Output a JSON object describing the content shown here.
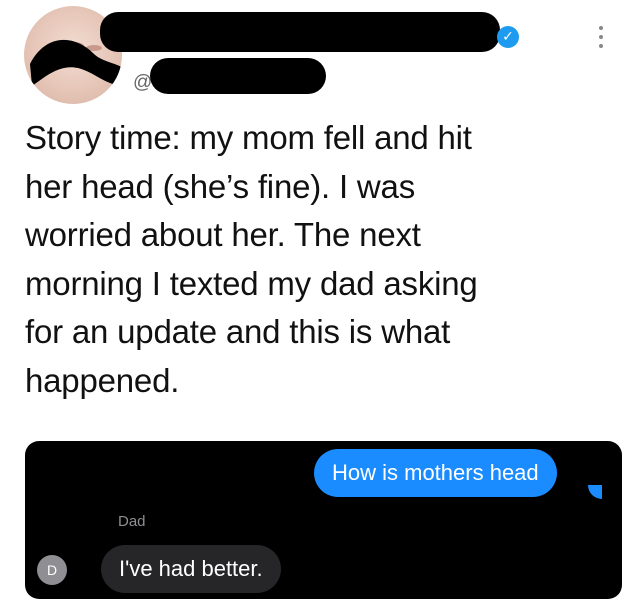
{
  "tweet": {
    "handle_visible": "@",
    "lines": [
      "Story time: my mom fell and hit",
      "her head (she’s fine). I was",
      "worried about her. The next",
      "morning I texted my dad asking",
      "for an update and this is what",
      "happened."
    ]
  },
  "icons": {
    "verified": "✓"
  },
  "chat": {
    "outgoing": "How is mothers head",
    "sender_name": "Dad",
    "sender_initial": "D",
    "incoming": "I've had better."
  },
  "colors": {
    "verified_blue": "#1d9bf0",
    "imessage_blue": "#1a8cff",
    "incoming_bubble": "#262628",
    "chat_background": "#000000"
  }
}
